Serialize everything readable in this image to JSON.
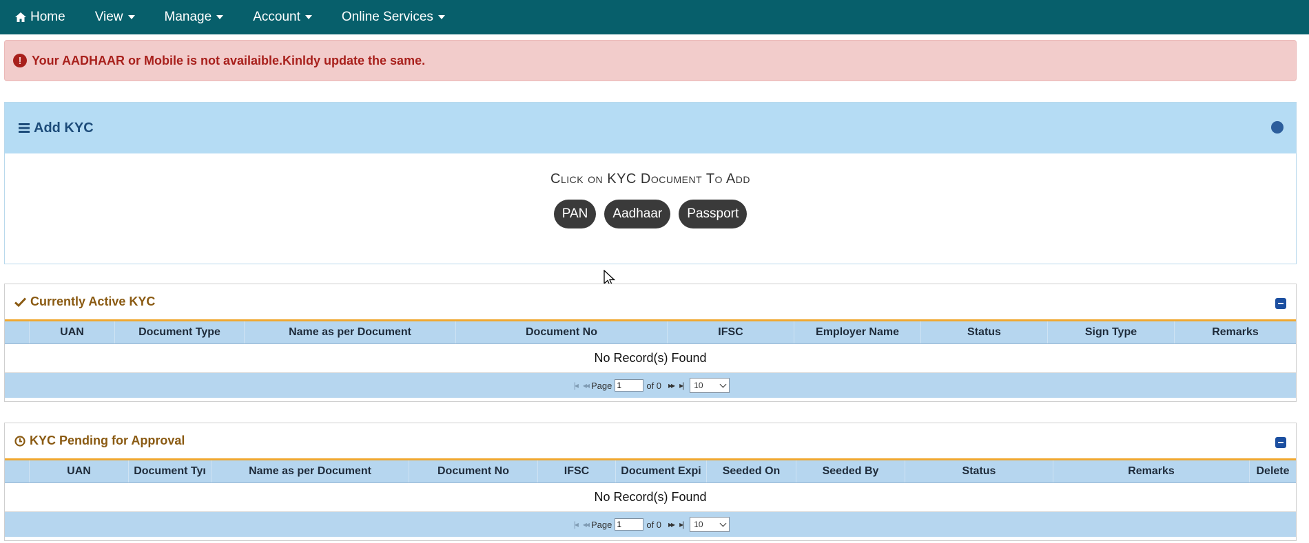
{
  "nav": {
    "items": [
      {
        "label": "Home",
        "icon": "home-icon",
        "dropdown": false
      },
      {
        "label": "View",
        "dropdown": true
      },
      {
        "label": "Manage",
        "dropdown": true
      },
      {
        "label": "Account",
        "dropdown": true
      },
      {
        "label": "Online Services",
        "dropdown": true
      }
    ],
    "background": "#075f6b"
  },
  "alert": {
    "message": "Your AADHAAR or Mobile is not availaible.Kinldy update the same.",
    "icon": "exclamation-circle-icon",
    "color": "#a8201c"
  },
  "add_kyc": {
    "title": "Add KYC",
    "prompt": "Click on KYC Document To Add",
    "documents": [
      "PAN",
      "Aadhaar",
      "Passport"
    ]
  },
  "active_kyc": {
    "title": "Currently Active KYC",
    "icon": "check-icon",
    "columns": [
      "UAN",
      "Document Type",
      "Name as per Document",
      "Document No",
      "IFSC",
      "Employer Name",
      "Status",
      "Sign Type",
      "Remarks"
    ],
    "empty_message": "No Record(s) Found",
    "pager": {
      "page_label": "Page",
      "page_value": "1",
      "of_label": "of 0",
      "page_size": "10"
    }
  },
  "pending_kyc": {
    "title": "KYC Pending for Approval",
    "icon": "clock-icon",
    "columns": [
      "UAN",
      "Document Tyı",
      "Name as per Document",
      "Document No",
      "IFSC",
      "Document Expi",
      "Seeded On",
      "Seeded By",
      "Status",
      "Remarks",
      "Delete"
    ],
    "empty_message": "No Record(s) Found",
    "pager": {
      "page_label": "Page",
      "page_value": "1",
      "of_label": "of 0",
      "page_size": "10"
    }
  }
}
